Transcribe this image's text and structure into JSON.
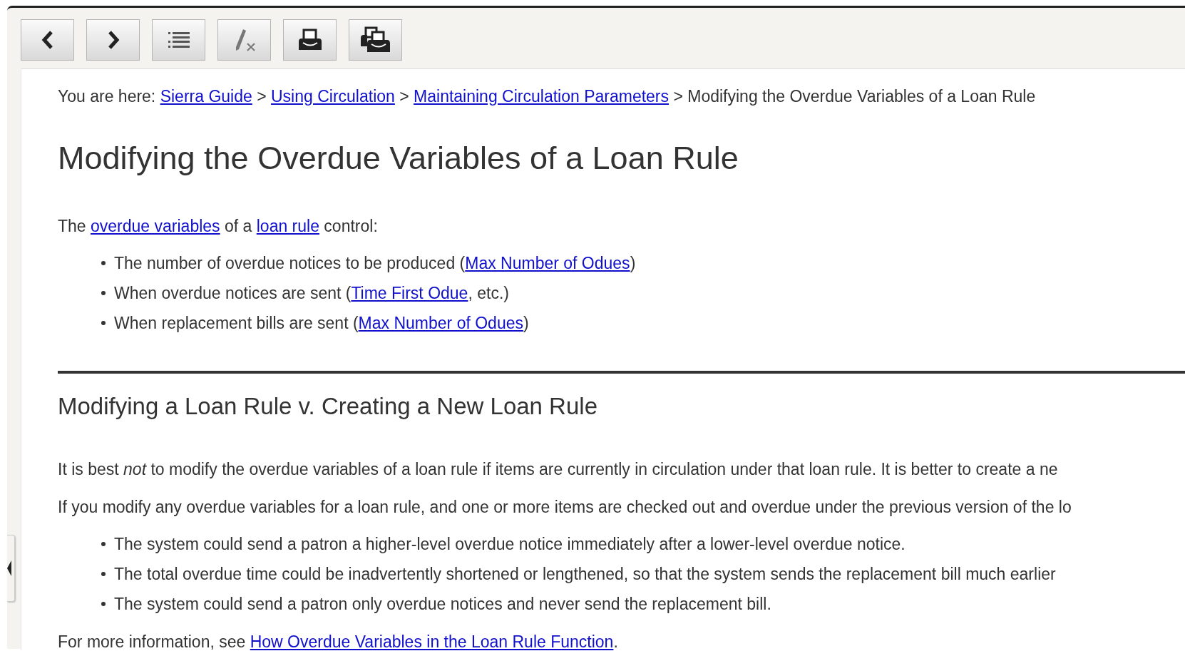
{
  "toolbar": [
    {
      "kind": "back"
    },
    {
      "kind": "forward"
    },
    {
      "kind": "contents"
    },
    {
      "kind": "clear-highlight"
    },
    {
      "kind": "print"
    },
    {
      "kind": "print-all"
    }
  ],
  "breadcrumb": {
    "prefix": "You are here:",
    "items": [
      {
        "kind": "link",
        "text": "Sierra Guide"
      },
      {
        "kind": "separator",
        "text": ">"
      },
      {
        "kind": "link",
        "text": "Using Circulation"
      },
      {
        "kind": "separator",
        "text": ">"
      },
      {
        "kind": "link",
        "text": "Maintaining Circulation Parameters"
      },
      {
        "kind": "separator",
        "text": ">"
      },
      {
        "kind": "current",
        "text": "Modifying the Overdue Variables of a Loan Rule"
      }
    ]
  },
  "title": "Modifying the Overdue Variables of a Loan Rule",
  "blocks": [
    {
      "kind": "paragraph",
      "parts": [
        {
          "text": "The "
        },
        {
          "link": "overdue variables"
        },
        {
          "text": " of a "
        },
        {
          "link": "loan rule"
        },
        {
          "text": " control:"
        }
      ]
    },
    {
      "kind": "list",
      "items": [
        {
          "parts": [
            {
              "text": "The number of overdue notices to be produced ("
            },
            {
              "link": "Max Number of Odues"
            },
            {
              "text": ")"
            }
          ]
        },
        {
          "parts": [
            {
              "text": "When overdue notices are sent ("
            },
            {
              "link": "Time First Odue"
            },
            {
              "text": ", etc.)"
            }
          ]
        },
        {
          "parts": [
            {
              "text": "When replacement bills are sent ("
            },
            {
              "link": "Max Number of Odues"
            },
            {
              "text": ")"
            }
          ]
        }
      ]
    },
    {
      "kind": "rule"
    },
    {
      "kind": "heading",
      "text": "Modifying a Loan Rule v. Creating a New Loan Rule"
    },
    {
      "kind": "paragraph",
      "parts": [
        {
          "text": "It is best *not* to modify the overdue variables of a loan rule if items are currently in circulation under that loan rule. It is better to create a ne"
        }
      ]
    },
    {
      "kind": "paragraph",
      "parts": [
        {
          "text": "If you modify any overdue variables for a loan rule, and one or more items are checked out and overdue under the previous version of the lo"
        }
      ]
    },
    {
      "kind": "list",
      "items": [
        {
          "parts": [
            {
              "text": "The system could send a patron a higher-level overdue notice immediately after a lower-level overdue notice."
            }
          ]
        },
        {
          "parts": [
            {
              "text": "The total overdue time could be inadvertently shortened or lengthened, so that the system sends the replacement bill much earlier"
            }
          ]
        },
        {
          "parts": [
            {
              "text": "The system could send a patron only overdue notices and never send the replacement bill."
            }
          ]
        }
      ]
    },
    {
      "kind": "paragraph",
      "parts": [
        {
          "text": "For more information, see "
        },
        {
          "link": "How Overdue Variables in the Loan Rule Function"
        },
        {
          "text": "."
        }
      ]
    }
  ]
}
